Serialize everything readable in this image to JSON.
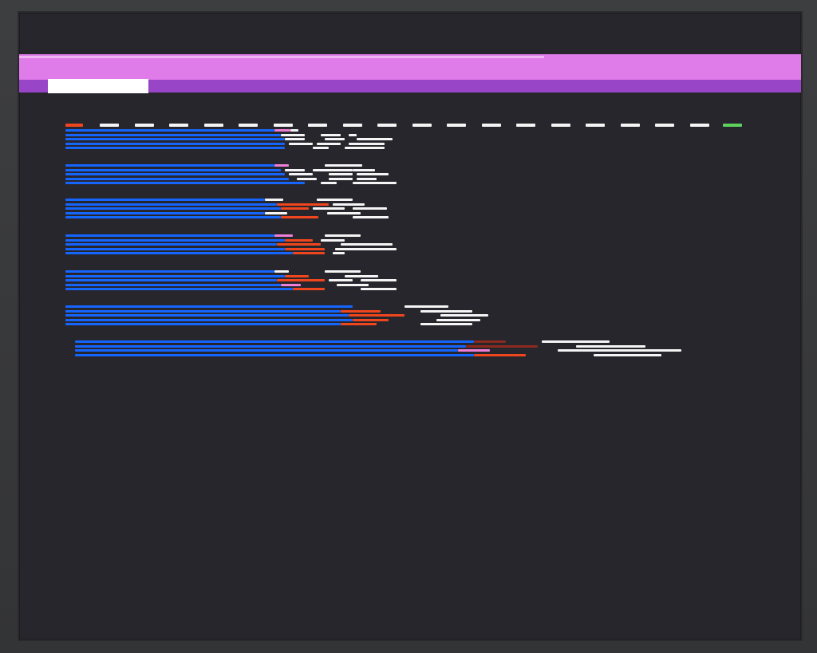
{
  "screen": {
    "background": "#28262d",
    "header_band_color": "#df7ce9",
    "sub_band_color": "#9845c7",
    "active_block_color": "#ffffff"
  },
  "palette": {
    "blue": "#1565ff",
    "red": "#f0461e",
    "white": "#f5f5f5",
    "pink": "#ef7fd6",
    "green": "#5dd35d",
    "dark_red": "#8a2a1e"
  },
  "timeline": {
    "start_marker_color": "red",
    "end_marker_color": "green",
    "white_dash_count": 18
  },
  "groups": [
    {
      "lines": [
        [
          [
            "blue",
            0,
            262
          ],
          [
            "pink",
            262,
            282
          ],
          [
            "white",
            282,
            292
          ]
        ],
        [
          [
            "blue",
            0,
            270
          ],
          [
            "white",
            270,
            300
          ],
          [
            "white",
            320,
            345
          ],
          [
            "white",
            355,
            365
          ]
        ],
        [
          [
            "blue",
            0,
            275
          ],
          [
            "white",
            275,
            300
          ],
          [
            "white",
            325,
            350
          ],
          [
            "white",
            365,
            410
          ]
        ],
        [
          [
            "blue",
            0,
            275
          ],
          [
            "white",
            280,
            310
          ],
          [
            "white",
            315,
            345
          ],
          [
            "white",
            355,
            400
          ]
        ],
        [
          [
            "blue",
            0,
            275
          ],
          [
            "white",
            310,
            330
          ],
          [
            "white",
            350,
            400
          ]
        ]
      ]
    },
    {
      "lines": [
        [
          [
            "blue",
            0,
            262
          ],
          [
            "pink",
            262,
            280
          ],
          [
            "white",
            325,
            372
          ]
        ],
        [
          [
            "blue",
            0,
            270
          ],
          [
            "white",
            275,
            300
          ],
          [
            "white",
            310,
            360
          ],
          [
            "white",
            360,
            388
          ]
        ],
        [
          [
            "blue",
            0,
            275
          ],
          [
            "white",
            280,
            310
          ],
          [
            "white",
            330,
            360
          ],
          [
            "white",
            365,
            405
          ]
        ],
        [
          [
            "blue",
            0,
            280
          ],
          [
            "white",
            290,
            315
          ],
          [
            "white",
            330,
            360
          ],
          [
            "white",
            365,
            390
          ]
        ],
        [
          [
            "blue",
            0,
            300
          ],
          [
            "white",
            320,
            340
          ],
          [
            "white",
            360,
            415
          ]
        ]
      ]
    },
    {
      "lines": [
        [
          [
            "blue",
            0,
            250
          ],
          [
            "white",
            250,
            273
          ],
          [
            "white",
            315,
            360
          ]
        ],
        [
          [
            "blue",
            0,
            265
          ],
          [
            "red",
            265,
            330
          ],
          [
            "white",
            335,
            375
          ]
        ],
        [
          [
            "blue",
            0,
            270
          ],
          [
            "red",
            270,
            305
          ],
          [
            "white",
            310,
            350
          ],
          [
            "white",
            360,
            403
          ]
        ],
        [
          [
            "blue",
            0,
            250
          ],
          [
            "white",
            250,
            278
          ],
          [
            "white",
            328,
            370
          ]
        ],
        [
          [
            "blue",
            0,
            270
          ],
          [
            "red",
            270,
            317
          ],
          [
            "white",
            360,
            405
          ]
        ]
      ]
    },
    {
      "lines": [
        [
          [
            "blue",
            0,
            262
          ],
          [
            "pink",
            262,
            285
          ],
          [
            "white",
            325,
            370
          ]
        ],
        [
          [
            "blue",
            0,
            275
          ],
          [
            "red",
            275,
            310
          ],
          [
            "white",
            320,
            350
          ]
        ],
        [
          [
            "blue",
            0,
            265
          ],
          [
            "red",
            265,
            320
          ],
          [
            "white",
            345,
            375
          ],
          [
            "white",
            370,
            410
          ]
        ],
        [
          [
            "blue",
            0,
            275
          ],
          [
            "red",
            275,
            325
          ],
          [
            "white",
            338,
            392
          ],
          [
            "white",
            370,
            415
          ]
        ],
        [
          [
            "blue",
            0,
            285
          ],
          [
            "red",
            285,
            325
          ],
          [
            "white",
            335,
            350
          ]
        ]
      ]
    },
    {
      "lines": [
        [
          [
            "blue",
            0,
            262
          ],
          [
            "white",
            262,
            280
          ],
          [
            "white",
            325,
            370
          ]
        ],
        [
          [
            "blue",
            0,
            275
          ],
          [
            "red",
            275,
            305
          ],
          [
            "white",
            350,
            392
          ]
        ],
        [
          [
            "blue",
            0,
            265
          ],
          [
            "red",
            265,
            325
          ],
          [
            "white",
            330,
            360
          ],
          [
            "white",
            370,
            415
          ]
        ],
        [
          [
            "blue",
            0,
            270
          ],
          [
            "pink",
            270,
            295
          ],
          [
            "white",
            340,
            380
          ]
        ],
        [
          [
            "blue",
            0,
            285
          ],
          [
            "red",
            285,
            325
          ],
          [
            "white",
            370,
            415
          ]
        ]
      ]
    },
    {
      "lines": [
        [
          [
            "blue",
            0,
            360
          ],
          [
            "white",
            425,
            480
          ]
        ],
        [
          [
            "blue",
            0,
            345
          ],
          [
            "red",
            345,
            395
          ],
          [
            "white",
            445,
            510
          ]
        ],
        [
          [
            "blue",
            0,
            355
          ],
          [
            "red",
            355,
            425
          ],
          [
            "white",
            470,
            530
          ]
        ],
        [
          [
            "blue",
            0,
            360
          ],
          [
            "red",
            360,
            405
          ],
          [
            "white",
            465,
            520
          ]
        ],
        [
          [
            "blue",
            0,
            345
          ],
          [
            "red",
            345,
            390
          ],
          [
            "white",
            445,
            510
          ]
        ]
      ]
    },
    {
      "lines": [
        [
          [
            "blue",
            0,
            500
          ],
          [
            "dark_red",
            500,
            540
          ],
          [
            "white",
            585,
            670
          ]
        ],
        [
          [
            "blue",
            0,
            490
          ],
          [
            "dark_red",
            490,
            580
          ],
          [
            "white",
            628,
            715
          ]
        ],
        [
          [
            "blue",
            0,
            480
          ],
          [
            "pink",
            480,
            520
          ],
          [
            "white",
            605,
            690
          ],
          [
            "white",
            670,
            760
          ]
        ],
        [
          [
            "blue",
            0,
            500
          ],
          [
            "red",
            500,
            565
          ],
          [
            "white",
            650,
            735
          ]
        ]
      ]
    }
  ]
}
